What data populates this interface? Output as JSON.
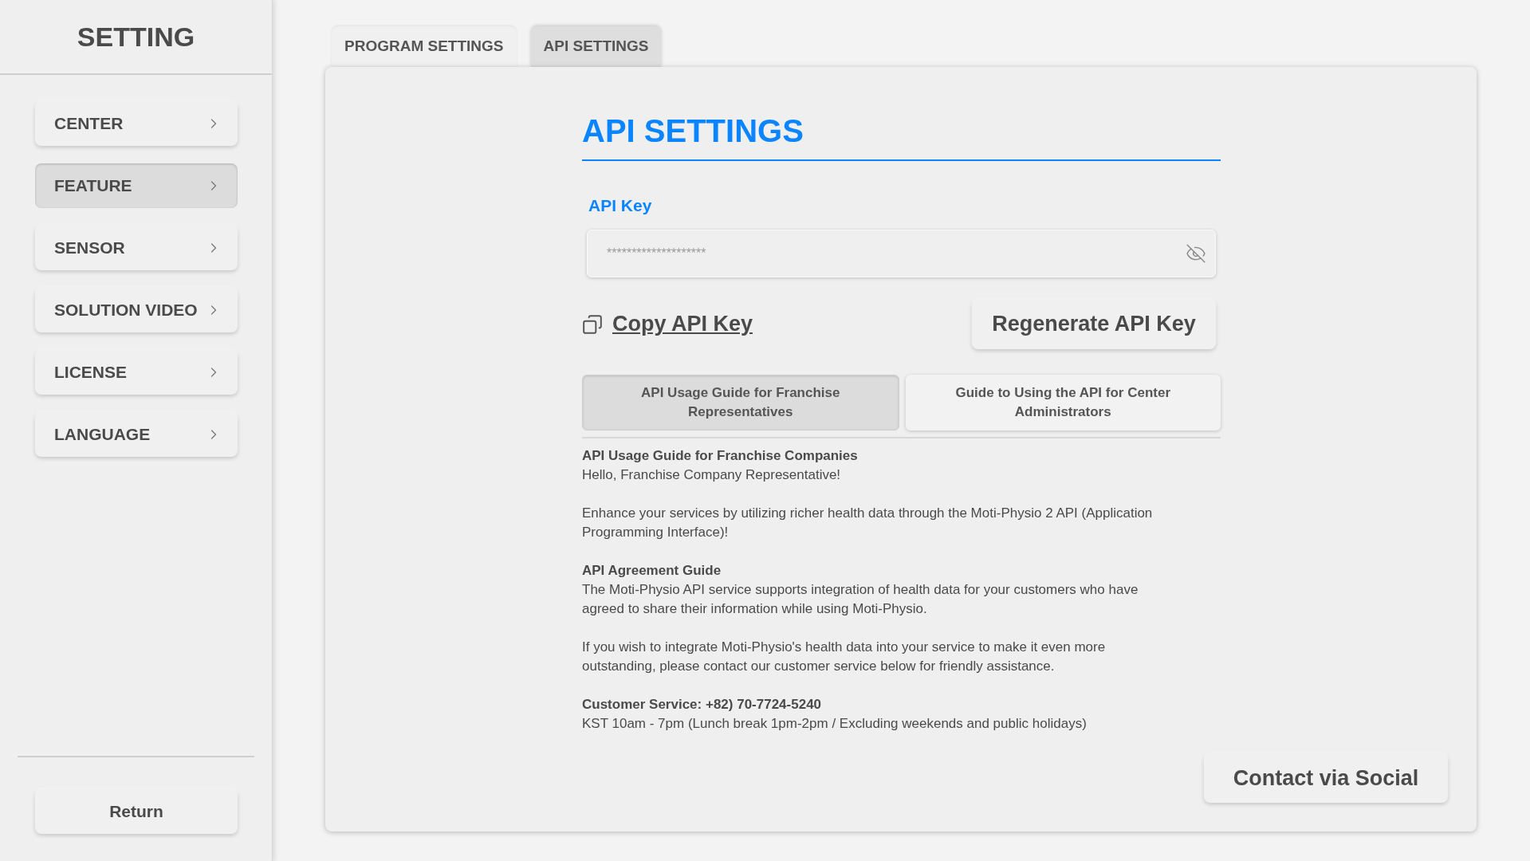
{
  "sidebar": {
    "title": "SETTING",
    "items": [
      {
        "label": "CENTER",
        "selected": false
      },
      {
        "label": "FEATURE",
        "selected": true
      },
      {
        "label": "SENSOR",
        "selected": false
      },
      {
        "label": "SOLUTION VIDEO",
        "selected": false
      },
      {
        "label": "LICENSE",
        "selected": false
      },
      {
        "label": "LANGUAGE",
        "selected": false
      }
    ],
    "return_button": "Return"
  },
  "tabs": [
    {
      "label": "PROGRAM SETTINGS",
      "selected": false
    },
    {
      "label": "API SETTINGS",
      "selected": true
    }
  ],
  "panel": {
    "title": "API SETTINGS",
    "api_key": {
      "label": "API Key",
      "value": "********************"
    },
    "copy_link": "Copy API Key",
    "regenerate_button": "Regenerate API Key",
    "guide_tabs": [
      {
        "label": "API Usage Guide for Franchise Representatives",
        "selected": true
      },
      {
        "label": "Guide to Using the API for Center Administrators",
        "selected": false
      }
    ],
    "sections": [
      {
        "heading": "API Usage Guide for Franchise Companies",
        "paragraphs": [
          "Hello, Franchise Company Representative!",
          "Enhance your services by utilizing richer health data through the Moti-Physio 2 API (Application Programming Interface)!"
        ]
      },
      {
        "heading": "API Agreement Guide",
        "paragraphs": [
          "The Moti-Physio API service supports integration of health data for your customers who have agreed to share their information while using Moti-Physio.",
          "If you wish to integrate Moti-Physio's health data into your service to make it even more outstanding, please contact our customer service below for friendly assistance."
        ]
      },
      {
        "heading": "Customer Service: +82) 70-7724-5240",
        "paragraphs": [
          "KST 10am - 7pm (Lunch break 1pm-2pm / Excluding weekends and public holidays)"
        ]
      }
    ],
    "contact_button": "Contact via Social"
  }
}
